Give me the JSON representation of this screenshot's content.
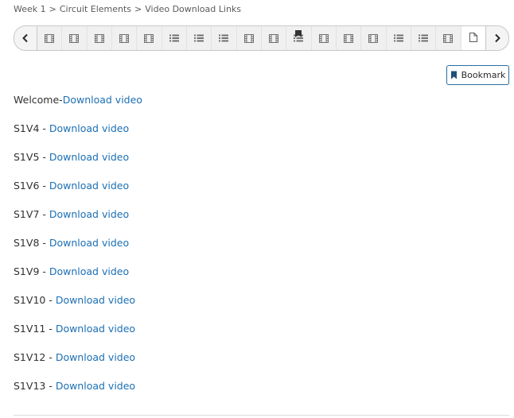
{
  "breadcrumb": {
    "items": [
      "Week 1",
      "Circuit Elements",
      "Video Download Links"
    ],
    "separator": ">"
  },
  "sequence_nav": {
    "prev_icon": "chevron-left-icon",
    "next_icon": "chevron-right-icon",
    "tabs": [
      {
        "icon": "video-icon"
      },
      {
        "icon": "video-icon"
      },
      {
        "icon": "video-icon"
      },
      {
        "icon": "video-icon"
      },
      {
        "icon": "video-icon"
      },
      {
        "icon": "list-icon"
      },
      {
        "icon": "list-icon"
      },
      {
        "icon": "list-icon"
      },
      {
        "icon": "video-icon"
      },
      {
        "icon": "video-icon"
      },
      {
        "icon": "list-icon",
        "bookmarked": true
      },
      {
        "icon": "video-icon"
      },
      {
        "icon": "video-icon"
      },
      {
        "icon": "video-icon"
      },
      {
        "icon": "list-icon"
      },
      {
        "icon": "list-icon"
      },
      {
        "icon": "video-icon"
      },
      {
        "icon": "document-icon",
        "active": true
      }
    ]
  },
  "bookmark_button": {
    "label": "Bookmark",
    "icon": "bookmark-icon"
  },
  "videos": [
    {
      "prefix": "Welcome-",
      "link": "Download video"
    },
    {
      "prefix": "S1V4 - ",
      "link": "Download video"
    },
    {
      "prefix": "S1V5 - ",
      "link": "Download video"
    },
    {
      "prefix": "S1V6 - ",
      "link": "Download video"
    },
    {
      "prefix": "S1V7 - ",
      "link": "Download video"
    },
    {
      "prefix": "S1V8 - ",
      "link": "Download video"
    },
    {
      "prefix": "S1V9 - ",
      "link": "Download video"
    },
    {
      "prefix": "S1V10 - ",
      "link": "Download video"
    },
    {
      "prefix": "S1V11 - ",
      "link": "Download video"
    },
    {
      "prefix": "S1V12 - ",
      "link": "Download video"
    },
    {
      "prefix": "S1V13 - ",
      "link": "Download video"
    }
  ],
  "colors": {
    "link": "#1c6fb4",
    "accent_border": "#2a6ea0",
    "icon": "#707070",
    "active_icon": "#5a5a5a",
    "flag": "#333333"
  }
}
